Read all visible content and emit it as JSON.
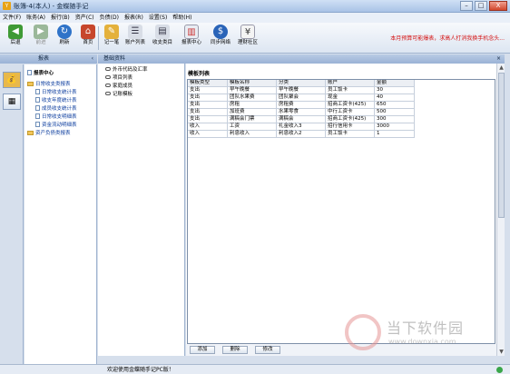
{
  "window": {
    "title": "账簿-4(本人) - 金蝶随手记",
    "app_icon": "Y",
    "minimize": "–",
    "maximize": "□",
    "close": "X"
  },
  "menu": [
    "文件(F)",
    "账务(A)",
    "报行(B)",
    "资产(C)",
    "负债(D)",
    "报表(R)",
    "设置(S)",
    "帮助(H)"
  ],
  "toolbar": {
    "back": "后退",
    "forward": "前进",
    "refresh": "刷新",
    "home": "首页",
    "quick_entry": "记一笔",
    "account_list": "账户列表",
    "income_expense": "收支类目",
    "report_center": "报表中心",
    "sync": "同步网络",
    "finance_community": "理财社区",
    "notice": "本月预算可能爆表，求高人打消我换手机念头..."
  },
  "left_panel": {
    "title": "报表",
    "pin": "‹",
    "tree": {
      "root": "报表中心",
      "group1": "日常收支类报表",
      "items": [
        "日常收支统计表",
        "收支年度统计表",
        "成员收支统计表",
        "日常收支明细表",
        "资金流动明细表"
      ],
      "group2": "资产负债类报表"
    }
  },
  "main_panel": {
    "title": "基础资料",
    "close": "×",
    "tree": [
      "外币代码及汇率",
      "项目列表",
      "家庭成员",
      "记账模板"
    ],
    "grid_caption": "模板列表",
    "columns": [
      "模板类型",
      "模板名称",
      "分类",
      "账户",
      "金额"
    ],
    "rows": [
      [
        "支出",
        "早午晚餐",
        "早午晚餐",
        "员工饭卡",
        "30"
      ],
      [
        "支出",
        "团队水果费",
        "团队聚会",
        "现金",
        "40"
      ],
      [
        "支出",
        "房租",
        "房租费",
        "招商工资卡(425)",
        "650"
      ],
      [
        "支出",
        "加班费",
        "水果零食",
        "中行工资卡",
        "500"
      ],
      [
        "支出",
        "满稿会门票",
        "满稿会",
        "招商工资卡(425)",
        "300"
      ],
      [
        "收入",
        "工资",
        "礼金收入3",
        "招行信用卡",
        "3000"
      ],
      [
        "收入",
        "利息收入",
        "利息收入2",
        "员工饭卡",
        "1"
      ]
    ],
    "buttons": {
      "add": "添加",
      "delete": "删除",
      "modify": "修改"
    }
  },
  "status": {
    "text": "欢迎使用金蝶随手记PC版！"
  },
  "watermark": {
    "text": "当下软件园",
    "url": "www.downxia.com"
  }
}
